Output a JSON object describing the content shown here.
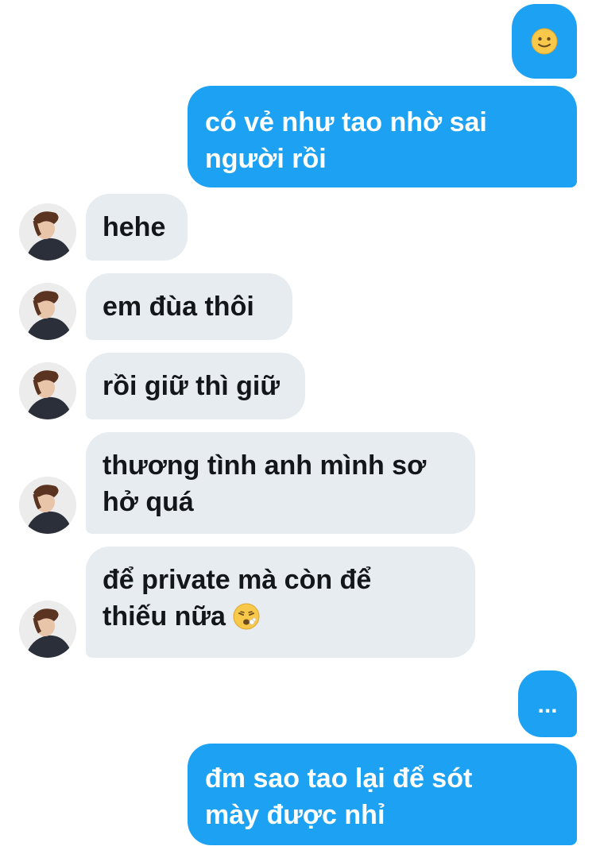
{
  "messages": {
    "m1": {
      "emoji": "slightly-smiling-face-icon"
    },
    "m2": {
      "text": "có vẻ như tao nhờ sai\nngười rồi"
    },
    "m3": {
      "text": "hehe"
    },
    "m4": {
      "text": "em đùa thôi"
    },
    "m5": {
      "text": "rồi giữ thì giữ"
    },
    "m6": {
      "text": "thương tình anh mình sơ\nhở quá"
    },
    "m7": {
      "text": "để private mà còn để\nthiếu nữa ",
      "emoji": "tired-face-icon"
    },
    "m8": {
      "text": "..."
    },
    "m9": {
      "text": "đm sao tao lại để sót\nmày được nhỉ"
    }
  },
  "colors": {
    "outgoing_bubble": "#1da1f2",
    "incoming_bubble": "#e6ecf0",
    "incoming_text": "#14171a",
    "outgoing_text": "#ffffff"
  }
}
